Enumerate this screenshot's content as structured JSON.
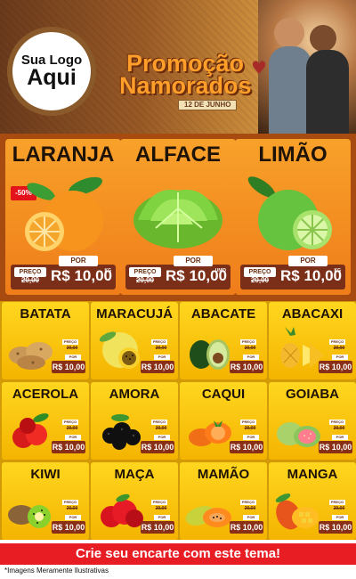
{
  "header": {
    "logo_line1": "Sua Logo",
    "logo_line2": "Aqui",
    "promo_line1": "Promoção",
    "promo_line2": "Namorados",
    "date": "12 DE JUNHO"
  },
  "featured": [
    {
      "name": "LARANJA",
      "discount": "-50%",
      "label_preco": "PREÇO",
      "old_price": "20,00",
      "label_por": "POR",
      "price": "R$ 10,00",
      "unit": "KG",
      "icon": "orange-icon"
    },
    {
      "name": "ALFACE",
      "discount": "",
      "label_preco": "PREÇO",
      "old_price": "20,00",
      "label_por": "POR",
      "price": "R$ 10,00",
      "unit": "UNID",
      "icon": "lettuce-icon"
    },
    {
      "name": "LIMÃO",
      "discount": "",
      "label_preco": "PREÇO",
      "old_price": "20,00",
      "label_por": "POR",
      "price": "R$ 10,00",
      "unit": "KG",
      "icon": "lime-icon"
    }
  ],
  "products": [
    {
      "name": "BATATA",
      "old_price": "20,00",
      "price": "R$ 10,00",
      "icon": "potato-icon"
    },
    {
      "name": "MARACUJÁ",
      "old_price": "20,00",
      "price": "R$ 10,00",
      "icon": "passionfruit-icon"
    },
    {
      "name": "ABACATE",
      "old_price": "20,00",
      "price": "R$ 10,00",
      "icon": "avocado-icon"
    },
    {
      "name": "ABACAXI",
      "old_price": "20,00",
      "price": "R$ 10,00",
      "icon": "pineapple-icon"
    },
    {
      "name": "ACEROLA",
      "old_price": "20,00",
      "price": "R$ 10,00",
      "icon": "acerola-icon"
    },
    {
      "name": "AMORA",
      "old_price": "20,00",
      "price": "R$ 10,00",
      "icon": "blackberry-icon"
    },
    {
      "name": "CAQUI",
      "old_price": "20,00",
      "price": "R$ 10,00",
      "icon": "persimmon-icon"
    },
    {
      "name": "GOIABA",
      "old_price": "20,00",
      "price": "R$ 10,00",
      "icon": "guava-icon"
    },
    {
      "name": "KIWI",
      "old_price": "20,00",
      "price": "R$ 10,00",
      "icon": "kiwi-icon"
    },
    {
      "name": "MAÇA",
      "old_price": "20,00",
      "price": "R$ 10,00",
      "icon": "apple-icon"
    },
    {
      "name": "MAMÃO",
      "old_price": "20,00",
      "price": "R$ 10,00",
      "icon": "papaya-icon"
    },
    {
      "name": "MANGA",
      "old_price": "20,00",
      "price": "R$ 10,00",
      "icon": "mango-icon"
    }
  ],
  "cta": "Crie seu encarte com este tema!",
  "footer_note": "*Imagens Meramente Ilustrativas",
  "colors": {
    "header_brown": "#8b5a2b",
    "featured_orange": "#f28c22",
    "grid_yellow": "#f4b400",
    "price_box": "#7b2f19",
    "cta_red": "#e81d24"
  }
}
